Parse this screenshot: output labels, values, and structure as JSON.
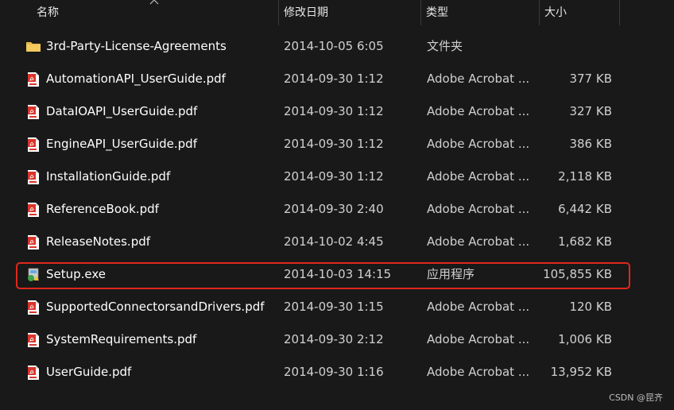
{
  "columns": {
    "name": "名称",
    "date": "修改日期",
    "type": "类型",
    "size": "大小"
  },
  "files": [
    {
      "name": "3rd-Party-License-Agreements",
      "date": "2014-10-05 6:05",
      "type": "文件夹",
      "size": "",
      "icon": "folder-icon"
    },
    {
      "name": "AutomationAPI_UserGuide.pdf",
      "date": "2014-09-30 1:12",
      "type": "Adobe Acrobat ...",
      "size": "377 KB",
      "icon": "pdf-file-icon"
    },
    {
      "name": "DataIOAPI_UserGuide.pdf",
      "date": "2014-09-30 1:12",
      "type": "Adobe Acrobat ...",
      "size": "327 KB",
      "icon": "pdf-file-icon"
    },
    {
      "name": "EngineAPI_UserGuide.pdf",
      "date": "2014-09-30 1:12",
      "type": "Adobe Acrobat ...",
      "size": "386 KB",
      "icon": "pdf-file-icon"
    },
    {
      "name": "InstallationGuide.pdf",
      "date": "2014-09-30 1:12",
      "type": "Adobe Acrobat ...",
      "size": "2,118 KB",
      "icon": "pdf-file-icon"
    },
    {
      "name": "ReferenceBook.pdf",
      "date": "2014-09-30 2:40",
      "type": "Adobe Acrobat ...",
      "size": "6,442 KB",
      "icon": "pdf-file-icon"
    },
    {
      "name": "ReleaseNotes.pdf",
      "date": "2014-10-02 4:45",
      "type": "Adobe Acrobat ...",
      "size": "1,682 KB",
      "icon": "pdf-file-icon"
    },
    {
      "name": "Setup.exe",
      "date": "2014-10-03 14:15",
      "type": "应用程序",
      "size": "105,855 KB",
      "icon": "setup-exe-icon"
    },
    {
      "name": "SupportedConnectorsandDrivers.pdf",
      "date": "2014-09-30 1:15",
      "type": "Adobe Acrobat ...",
      "size": "120 KB",
      "icon": "pdf-file-icon"
    },
    {
      "name": "SystemRequirements.pdf",
      "date": "2014-09-30 2:12",
      "type": "Adobe Acrobat ...",
      "size": "1,006 KB",
      "icon": "pdf-file-icon"
    },
    {
      "name": "UserGuide.pdf",
      "date": "2014-09-30 1:16",
      "type": "Adobe Acrobat ...",
      "size": "13,952 KB",
      "icon": "pdf-file-icon"
    }
  ],
  "highlighted_file": "Setup.exe",
  "highlight_color": "#e0281c",
  "watermark": "CSDN @昆齐"
}
